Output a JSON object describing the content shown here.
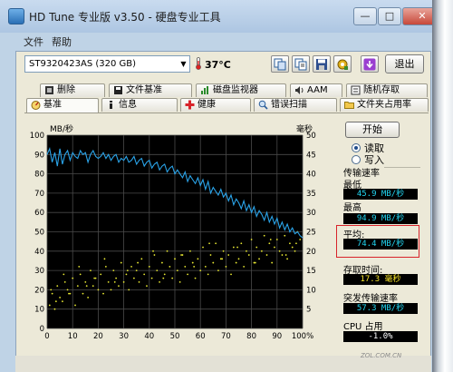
{
  "window": {
    "title": "HD Tune 专业版 v3.50 - 硬盘专业工具",
    "caption_buttons": [
      "—",
      "□",
      "✕"
    ]
  },
  "menu": [
    "文件",
    "帮助"
  ],
  "toolbar": {
    "drive": "ST9320423AS (320 GB)",
    "temperature": "37°C",
    "exit_label": "退出",
    "icons": [
      "copy-icon",
      "copy-text-icon",
      "save-icon",
      "options-icon",
      "download-icon"
    ]
  },
  "tabs_top": [
    {
      "label": "删除",
      "icon": "delete-icon"
    },
    {
      "label": "文件基准",
      "icon": "file-benchmark-icon"
    },
    {
      "label": "磁盘监视器",
      "icon": "disk-monitor-icon"
    },
    {
      "label": "AAM",
      "icon": "speaker-icon"
    },
    {
      "label": "随机存取",
      "icon": "random-access-icon"
    }
  ],
  "tabs_bottom": [
    {
      "label": "基准",
      "icon": "benchmark-icon",
      "active": true
    },
    {
      "label": "信息",
      "icon": "info-icon"
    },
    {
      "label": "健康",
      "icon": "health-icon"
    },
    {
      "label": "错误扫描",
      "icon": "error-scan-icon"
    },
    {
      "label": "文件夹占用率",
      "icon": "folder-usage-icon"
    }
  ],
  "controls": {
    "start_label": "开始",
    "read_label": "读取",
    "write_label": "写入",
    "selected": "read"
  },
  "stats": {
    "transfer_rate_label": "传输速率",
    "min_label": "最低",
    "min_value": "45.9 MB/秒",
    "max_label": "最高",
    "max_value": "94.9 MB/秒",
    "avg_label": "平均:",
    "avg_value": "74.4 MB/秒",
    "access_time_label": "存取时间:",
    "access_time_value": "17.3 毫秒",
    "burst_label": "突发传输速率",
    "burst_value": "57.3 MB/秒",
    "cpu_label": "CPU 占用",
    "cpu_value": "-1.0%"
  },
  "watermark": "ZOL.COM.CN",
  "colors": {
    "transfer_line": "#2aa3e8",
    "access_dots": "#e8e832",
    "chart_bg": "#000000",
    "grid": "#4a4a4a",
    "highlight_box": "#d8232a"
  },
  "chart_data": {
    "type": "line",
    "ylabel_left": "MB/秒",
    "ylabel_right": "毫秒",
    "ylim_left": [
      0,
      100
    ],
    "ylim_right": [
      0,
      50
    ],
    "xlim": [
      0,
      100
    ],
    "left_ticks": [
      0,
      10,
      20,
      30,
      40,
      50,
      60,
      70,
      80,
      90,
      100
    ],
    "right_ticks": [
      5,
      10,
      15,
      20,
      25,
      30,
      35,
      40,
      45,
      50
    ],
    "x_ticks": [
      "0",
      "10",
      "20",
      "30",
      "40",
      "50",
      "60",
      "70",
      "80",
      "90",
      "100%"
    ],
    "grid": true,
    "series": [
      {
        "kind": "transfer_rate",
        "axis": "left",
        "x": [
          0,
          1,
          2,
          3,
          4,
          5,
          6,
          7,
          8,
          9,
          10,
          11,
          12,
          13,
          14,
          15,
          16,
          17,
          18,
          19,
          20,
          21,
          22,
          23,
          24,
          25,
          26,
          27,
          28,
          29,
          30,
          31,
          32,
          33,
          34,
          35,
          36,
          37,
          38,
          39,
          40,
          41,
          42,
          43,
          44,
          45,
          46,
          47,
          48,
          49,
          50,
          51,
          52,
          53,
          54,
          55,
          56,
          57,
          58,
          59,
          60,
          61,
          62,
          63,
          64,
          65,
          66,
          67,
          68,
          69,
          70,
          71,
          72,
          73,
          74,
          75,
          76,
          77,
          78,
          79,
          80,
          81,
          82,
          83,
          84,
          85,
          86,
          87,
          88,
          89,
          90,
          91,
          92,
          93,
          94,
          95,
          96,
          97,
          98,
          99,
          100
        ],
        "y": [
          90,
          93,
          86,
          91,
          84,
          93,
          85,
          90,
          92,
          87,
          91,
          89,
          88,
          92,
          90,
          91,
          86,
          90,
          92,
          89,
          88,
          89,
          91,
          88,
          90,
          87,
          89,
          90,
          86,
          88,
          87,
          89,
          86,
          87,
          89,
          85,
          87,
          88,
          84,
          86,
          87,
          83,
          85,
          86,
          82,
          84,
          85,
          81,
          83,
          84,
          80,
          82,
          80,
          78,
          81,
          76,
          79,
          77,
          75,
          78,
          74,
          77,
          72,
          76,
          70,
          73,
          71,
          69,
          72,
          68,
          70,
          66,
          69,
          64,
          67,
          65,
          62,
          66,
          61,
          64,
          60,
          63,
          58,
          61,
          59,
          56,
          60,
          55,
          58,
          54,
          57,
          52,
          55,
          51,
          54,
          50,
          52,
          49,
          50,
          48,
          47
        ]
      },
      {
        "kind": "access_time",
        "axis": "right",
        "x": [
          1,
          2,
          3,
          4,
          5,
          6,
          7,
          8,
          9,
          10,
          11,
          12,
          13,
          14,
          15,
          16,
          17,
          18,
          19,
          20,
          21,
          22,
          23,
          24,
          25,
          26,
          27,
          28,
          29,
          30,
          31,
          32,
          33,
          34,
          35,
          36,
          37,
          38,
          39,
          40,
          41,
          42,
          43,
          44,
          45,
          46,
          47,
          48,
          49,
          50,
          51,
          52,
          53,
          54,
          55,
          56,
          57,
          58,
          59,
          60,
          61,
          62,
          63,
          64,
          65,
          66,
          67,
          68,
          69,
          70,
          71,
          72,
          73,
          74,
          75,
          76,
          77,
          78,
          79,
          80,
          81,
          82,
          83,
          84,
          85,
          86,
          87,
          88,
          89,
          90,
          91,
          92,
          93,
          94,
          95,
          96,
          97,
          98,
          99,
          1.5,
          3.5,
          6.5,
          8.5,
          12.5,
          15.5,
          18.5,
          22.5,
          26.5,
          31.5,
          35.5,
          41.5,
          45.5,
          52.5,
          57.5,
          63.5,
          68.5,
          74.5,
          81.5,
          87.5,
          93.5,
          97.5
        ],
        "y": [
          6,
          9,
          5,
          11,
          8,
          7,
          12,
          10,
          9,
          13,
          6,
          11,
          14,
          9,
          12,
          8,
          15,
          11,
          13,
          10,
          14,
          9,
          16,
          12,
          10,
          15,
          13,
          11,
          17,
          12,
          14,
          10,
          16,
          13,
          15,
          12,
          18,
          14,
          11,
          16,
          13,
          19,
          15,
          12,
          17,
          14,
          20,
          16,
          13,
          18,
          15,
          12,
          19,
          16,
          14,
          20,
          17,
          13,
          18,
          15,
          21,
          16,
          14,
          19,
          17,
          22,
          15,
          18,
          20,
          16,
          19,
          14,
          21,
          17,
          18,
          22,
          16,
          20,
          19,
          23,
          17,
          21,
          18,
          20,
          24,
          19,
          22,
          17,
          21,
          23,
          20,
          19,
          24,
          18,
          22,
          21,
          20,
          25,
          23,
          10,
          7,
          14,
          9,
          16,
          11,
          13,
          18,
          12,
          15,
          17,
          20,
          13,
          19,
          16,
          22,
          18,
          21,
          17,
          23,
          19,
          22
        ]
      }
    ]
  }
}
